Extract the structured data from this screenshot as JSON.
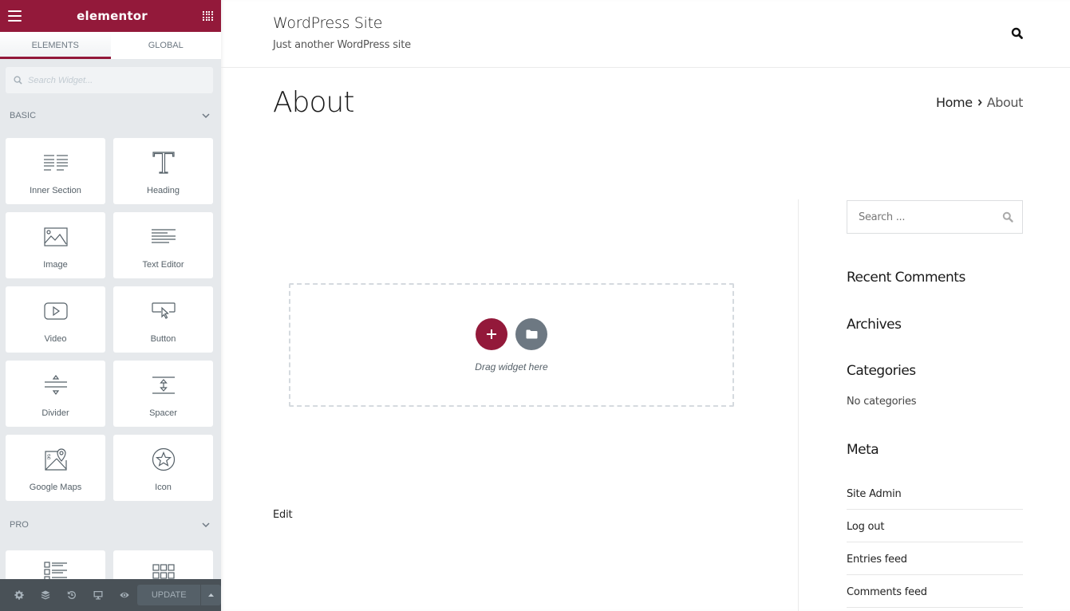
{
  "panel": {
    "logo": "elementor",
    "brand_color": "#93193a",
    "tabs": [
      {
        "label": "Elements",
        "active": true
      },
      {
        "label": "Global",
        "active": false
      }
    ],
    "search_placeholder": "Search Widget...",
    "categories": [
      {
        "label": "Basic",
        "widgets": [
          {
            "label": "Inner Section",
            "icon": "inner-section-icon"
          },
          {
            "label": "Heading",
            "icon": "heading-icon"
          },
          {
            "label": "Image",
            "icon": "image-icon"
          },
          {
            "label": "Text Editor",
            "icon": "text-editor-icon"
          },
          {
            "label": "Video",
            "icon": "video-icon"
          },
          {
            "label": "Button",
            "icon": "button-icon"
          },
          {
            "label": "Divider",
            "icon": "divider-icon"
          },
          {
            "label": "Spacer",
            "icon": "spacer-icon"
          },
          {
            "label": "Google Maps",
            "icon": "google-maps-icon"
          },
          {
            "label": "Icon",
            "icon": "star-icon"
          }
        ]
      },
      {
        "label": "Pro",
        "widgets": [
          {
            "label": "",
            "icon": "posts-icon"
          },
          {
            "label": "",
            "icon": "portfolio-icon"
          }
        ]
      }
    ],
    "footer": {
      "icons": [
        "settings-icon",
        "navigator-icon",
        "history-icon",
        "responsive-icon",
        "preview-icon"
      ],
      "update_label": "Update"
    }
  },
  "site": {
    "title": "WordPress Site",
    "description": "Just another WordPress site",
    "page_title": "About",
    "breadcrumb": [
      "Home",
      "About"
    ],
    "dropzone_text": "Drag widget here",
    "edit_link": "Edit",
    "sidebar": {
      "search_placeholder": "Search ...",
      "recent_comments_title": "Recent Comments",
      "archives_title": "Archives",
      "categories_title": "Categories",
      "categories_empty": "No categories",
      "meta_title": "Meta",
      "meta_links": [
        "Site Admin",
        "Log out",
        "Entries feed",
        "Comments feed"
      ]
    }
  }
}
